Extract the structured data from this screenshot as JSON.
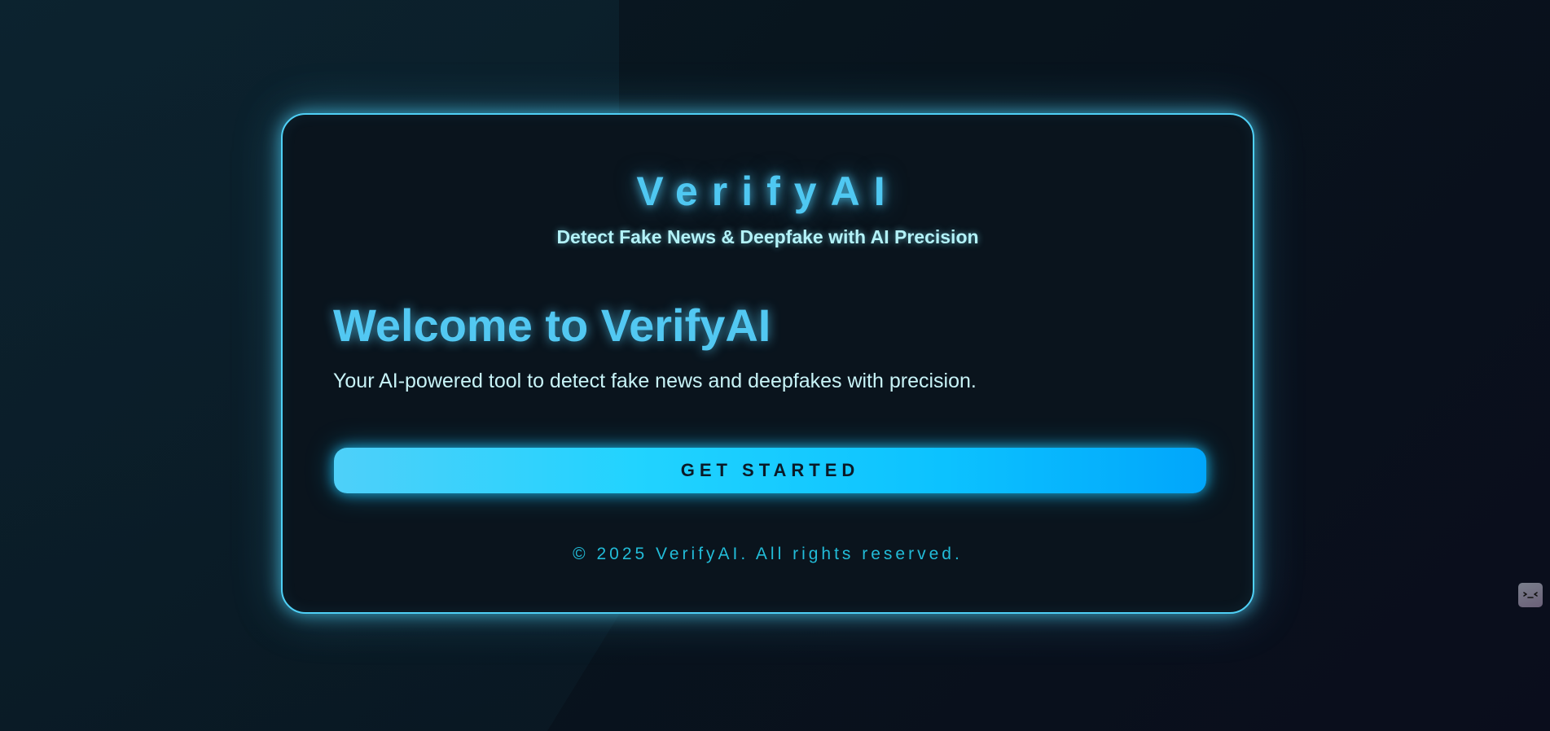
{
  "brand": {
    "name": "VerifyAI",
    "tagline": "Detect Fake News & Deepfake with AI Precision"
  },
  "hero": {
    "title": "Welcome to VerifyAI",
    "description": "Your AI-powered tool to detect fake news and deepfakes with precision."
  },
  "cta": {
    "label": "GET STARTED"
  },
  "footer": {
    "copyright": "© 2025 VerifyAI. All rights reserved."
  },
  "widget": {
    "icon": "terminal-face-icon"
  },
  "colors": {
    "accent": "#4fd0f6",
    "title": "#52c8f2",
    "button_start": "#4ed0f9",
    "button_end": "#01a6fb",
    "footer_text": "#22bcd8",
    "card_background": "#0a141d"
  }
}
